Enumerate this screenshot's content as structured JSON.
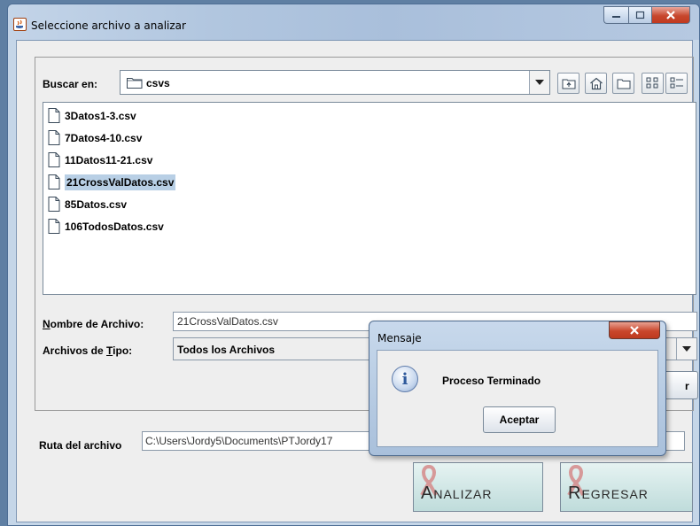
{
  "window": {
    "title": "Seleccione archivo a analizar"
  },
  "chooser": {
    "look_in_label": "Buscar en:",
    "look_in_value": "csvs",
    "toolbar_icons": [
      "up-folder-icon",
      "home-icon",
      "new-folder-icon",
      "list-view-icon",
      "details-view-icon"
    ],
    "files": [
      {
        "name": "3Datos1-3.csv",
        "selected": false
      },
      {
        "name": "7Datos4-10.csv",
        "selected": false
      },
      {
        "name": "11Datos11-21.csv",
        "selected": false
      },
      {
        "name": "21CrossValDatos.csv",
        "selected": true
      },
      {
        "name": "85Datos.csv",
        "selected": false
      },
      {
        "name": "106TodosDatos.csv",
        "selected": false
      }
    ],
    "filename_label": {
      "prefix": "N",
      "rest": "ombre de Archivo:"
    },
    "filename_value": "21CrossValDatos.csv",
    "filetype_label": {
      "prefix": "Archivos de ",
      "accel": "T",
      "rest": "ipo:"
    },
    "filetype_value": "Todos los Archivos",
    "partial_button_label": "r"
  },
  "path": {
    "label": "Ruta del archivo",
    "value": "C:\\Users\\Jordy5\\Documents\\PTJordy17"
  },
  "buttons": {
    "analizar": "Analizar",
    "regresar": "Regresar"
  },
  "dialog": {
    "title": "Mensaje",
    "message": "Proceso Terminado",
    "ok_label": "Aceptar",
    "icon": "info-icon"
  },
  "colors": {
    "selection": "#b8cfe5",
    "window_frame": "#c5d6e8",
    "close_button": "#c9462b",
    "big_button": "#bfdcdb"
  }
}
